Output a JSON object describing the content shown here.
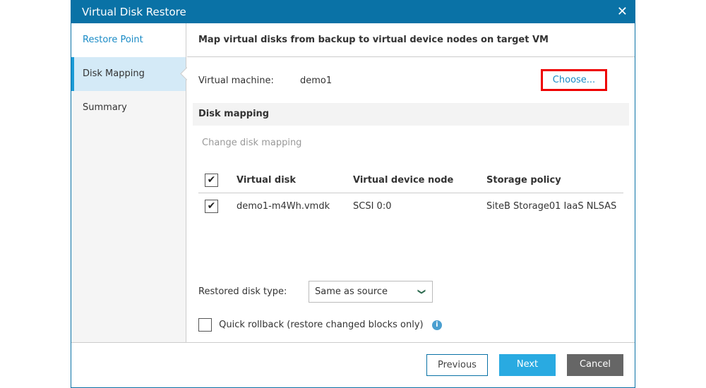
{
  "dialog": {
    "title": "Virtual Disk Restore"
  },
  "sidebar": {
    "items": [
      {
        "label": "Restore Point"
      },
      {
        "label": "Disk Mapping"
      },
      {
        "label": "Summary"
      }
    ]
  },
  "main": {
    "title": "Map virtual disks from backup to virtual device nodes on target VM",
    "vm_label": "Virtual machine:",
    "vm_value": "demo1",
    "choose_label": "Choose...",
    "section": "Disk mapping",
    "change_link": "Change disk mapping",
    "table": {
      "headers": [
        "Virtual disk",
        "Virtual device node",
        "Storage policy"
      ],
      "rows": [
        {
          "checked": true,
          "disk": "demo1-m4Wh.vmdk",
          "node": "SCSI 0:0",
          "policy": "SiteB Storage01 IaaS NLSAS"
        }
      ]
    },
    "disk_type_label": "Restored disk type:",
    "disk_type_value": "Same as source",
    "quick_rollback_label": "Quick rollback (restore changed blocks only)",
    "quick_rollback_checked": false
  },
  "footer": {
    "previous": "Previous",
    "next": "Next",
    "cancel": "Cancel"
  }
}
